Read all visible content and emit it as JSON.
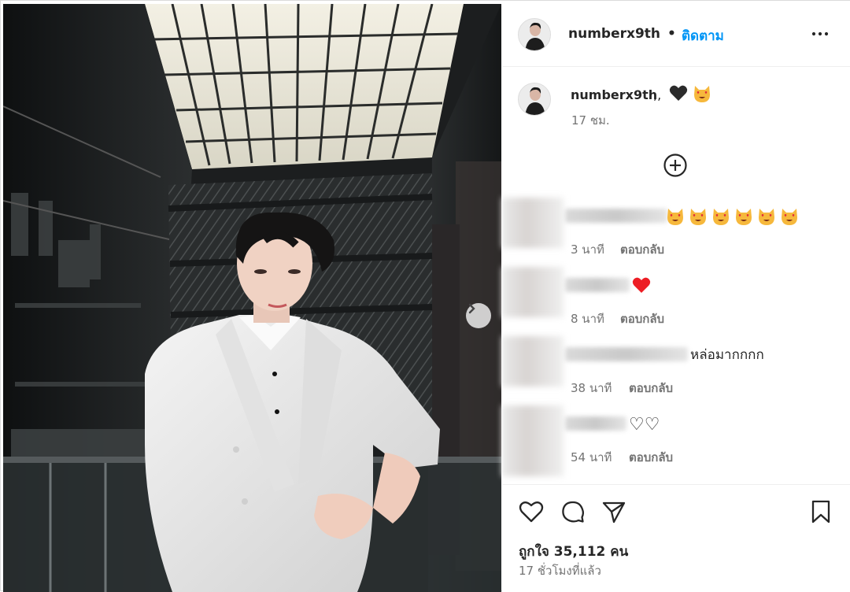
{
  "post": {
    "username": "numberx9th",
    "separator": "•",
    "follow_label": "ติดตาม",
    "more_icon": "more-horizontal-icon",
    "next_icon": "chevron-right-icon"
  },
  "caption": {
    "username": "numberx9th",
    "text": ",,",
    "emojis": [
      "black-heart",
      "heart-eyes-cat"
    ],
    "time": "17 ชม."
  },
  "load_more_icon": "plus-circle-icon",
  "comments": [
    {
      "text": "",
      "emojis": [
        "heart-eyes-cat",
        "heart-eyes-cat",
        "heart-eyes-cat",
        "heart-eyes-cat",
        "heart-eyes-cat",
        "heart-eyes-cat"
      ],
      "time": "3 นาที",
      "reply": "ตอบกลับ"
    },
    {
      "text": "",
      "emojis": [
        "red-heart"
      ],
      "time": "8 นาที",
      "reply": "ตอบกลับ"
    },
    {
      "text": "หล่อมากกกก",
      "emojis": [],
      "time": "38 นาที",
      "reply": "ตอบกลับ"
    },
    {
      "text": "♡♡",
      "emojis": [],
      "time": "54 นาที",
      "reply": "ตอบกลับ"
    }
  ],
  "actions": {
    "likes": "ถูกใจ 35,112 คน",
    "posted_ago": "17 ชั่วโมงที่แล้ว"
  },
  "colors": {
    "follow": "#0095f6",
    "muted": "#737373",
    "heart": "#ed1d24"
  }
}
